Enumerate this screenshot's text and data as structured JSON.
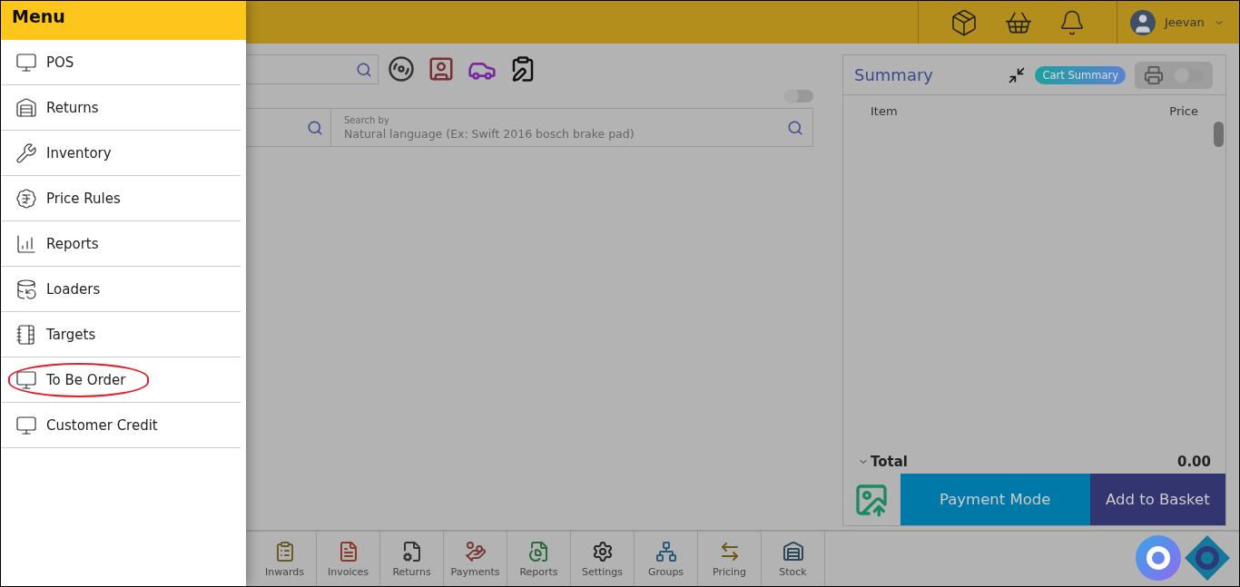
{
  "menu": {
    "title": "Menu",
    "items": [
      {
        "label": "POS",
        "circled": false
      },
      {
        "label": "Returns",
        "circled": false
      },
      {
        "label": "Inventory",
        "circled": false
      },
      {
        "label": "Price Rules",
        "circled": false
      },
      {
        "label": "Reports",
        "circled": false
      },
      {
        "label": "Loaders",
        "circled": false
      },
      {
        "label": "Targets",
        "circled": false
      },
      {
        "label": "To Be Order",
        "circled": true
      },
      {
        "label": "Customer Credit",
        "circled": false
      }
    ]
  },
  "header": {
    "user": "Jeevan"
  },
  "search": {
    "label": "Search by",
    "placeholder": "Natural language (Ex: Swift 2016 bosch brake pad)",
    "toggle_on": false
  },
  "summary": {
    "title": "Summary",
    "badge": "Cart Summary",
    "print_on": false,
    "columns": [
      "Item",
      "Price"
    ],
    "total_label": "Total",
    "total_value": "0.00"
  },
  "actions": [
    "Payment Mode",
    "Add to Basket"
  ],
  "toolbar": [
    {
      "label": "Inwards"
    },
    {
      "label": "Invoices"
    },
    {
      "label": "Returns"
    },
    {
      "label": "Payments"
    },
    {
      "label": "Reports"
    },
    {
      "label": "Settings"
    },
    {
      "label": "Groups"
    },
    {
      "label": "Pricing"
    },
    {
      "label": "Stock"
    }
  ]
}
